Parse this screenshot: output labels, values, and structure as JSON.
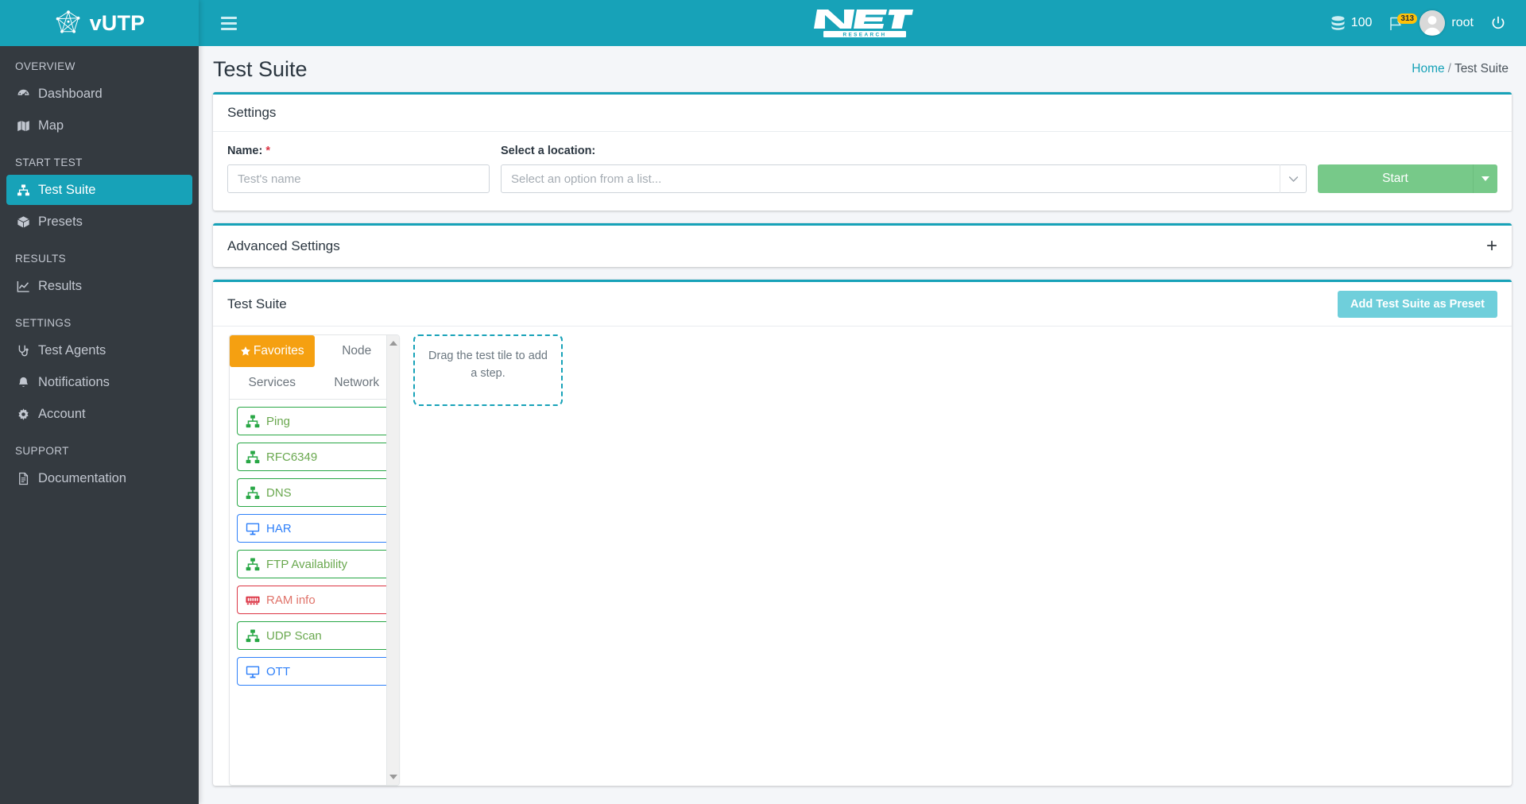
{
  "brand": {
    "name": "vUTP",
    "logo_icon": "network-graph-icon"
  },
  "topbar": {
    "menu_icon": "hamburger-icon",
    "logo": {
      "primary": "NET",
      "secondary": "RESEARCH"
    },
    "credits": {
      "icon": "database-icon",
      "value": "100"
    },
    "flag": {
      "icon": "flag-icon",
      "badge": "313"
    },
    "user": {
      "avatar_icon": "user-avatar-icon",
      "name": "root"
    },
    "logout": {
      "icon": "power-icon"
    }
  },
  "sidebar": {
    "sections": [
      {
        "header": "OVERVIEW",
        "items": [
          {
            "label": "Dashboard",
            "icon": "tachometer-icon",
            "active": false
          },
          {
            "label": "Map",
            "icon": "map-icon",
            "active": false
          }
        ]
      },
      {
        "header": "START TEST",
        "items": [
          {
            "label": "Test Suite",
            "icon": "sitemap-icon",
            "active": true
          },
          {
            "label": "Presets",
            "icon": "box-icon",
            "active": false
          }
        ]
      },
      {
        "header": "RESULTS",
        "items": [
          {
            "label": "Results",
            "icon": "chart-line-icon",
            "active": false
          }
        ]
      },
      {
        "header": "SETTINGS",
        "items": [
          {
            "label": "Test Agents",
            "icon": "stethoscope-icon",
            "active": false
          },
          {
            "label": "Notifications",
            "icon": "bell-icon",
            "active": false
          },
          {
            "label": "Account",
            "icon": "gear-icon",
            "active": false
          }
        ]
      },
      {
        "header": "SUPPORT",
        "items": [
          {
            "label": "Documentation",
            "icon": "file-text-icon",
            "active": false
          }
        ]
      }
    ]
  },
  "page": {
    "title": "Test Suite",
    "breadcrumb": {
      "home": "Home",
      "separator": "/",
      "current": "Test Suite"
    }
  },
  "settings_card": {
    "title": "Settings",
    "name_label": "Name:",
    "name_required_mark": "*",
    "name_value": "",
    "name_placeholder": "Test's name",
    "location_label": "Select a location:",
    "location_value": "",
    "location_placeholder": "Select an option from a list...",
    "start_button": "Start",
    "start_caret_icon": "caret-down-icon",
    "select_caret_icon": "chevron-down-icon"
  },
  "advanced_card": {
    "title": "Advanced Settings",
    "toggle_label": "+",
    "toggle_icon": "plus-icon"
  },
  "suite_card": {
    "title": "Test Suite",
    "preset_button": "Add Test Suite as Preset",
    "tabs": [
      {
        "label": "Favorites",
        "active": true,
        "icon": "star-icon"
      },
      {
        "label": "Node",
        "active": false
      },
      {
        "label": "Services",
        "active": false
      },
      {
        "label": "Network",
        "active": false
      }
    ],
    "tiles": [
      {
        "label": "Ping",
        "color": "green",
        "icon": "sitemap-icon"
      },
      {
        "label": "RFC6349",
        "color": "green",
        "icon": "sitemap-icon"
      },
      {
        "label": "DNS",
        "color": "green",
        "icon": "sitemap-icon"
      },
      {
        "label": "HAR",
        "color": "blue",
        "icon": "desktop-icon"
      },
      {
        "label": "FTP Availability",
        "color": "green",
        "icon": "sitemap-icon"
      },
      {
        "label": "RAM info",
        "color": "red",
        "icon": "memory-icon"
      },
      {
        "label": "UDP Scan",
        "color": "green",
        "icon": "sitemap-icon"
      },
      {
        "label": "OTT",
        "color": "blue",
        "icon": "desktop-icon"
      }
    ],
    "dropzone_text": "Drag the test tile to add a step.",
    "scroll_up_icon": "triangle-up-icon",
    "scroll_down_icon": "triangle-down-icon"
  },
  "colors": {
    "brand_teal": "#17a2b8",
    "sidebar_dark": "#343a40",
    "accent_orange": "#f5a011",
    "start_green": "#77c989",
    "preset_cyan": "#6fcfdb",
    "tile_green": "#28a745",
    "tile_blue": "#2d7ff9",
    "tile_red": "#dc3545",
    "badge_yellow": "#ffc107"
  }
}
